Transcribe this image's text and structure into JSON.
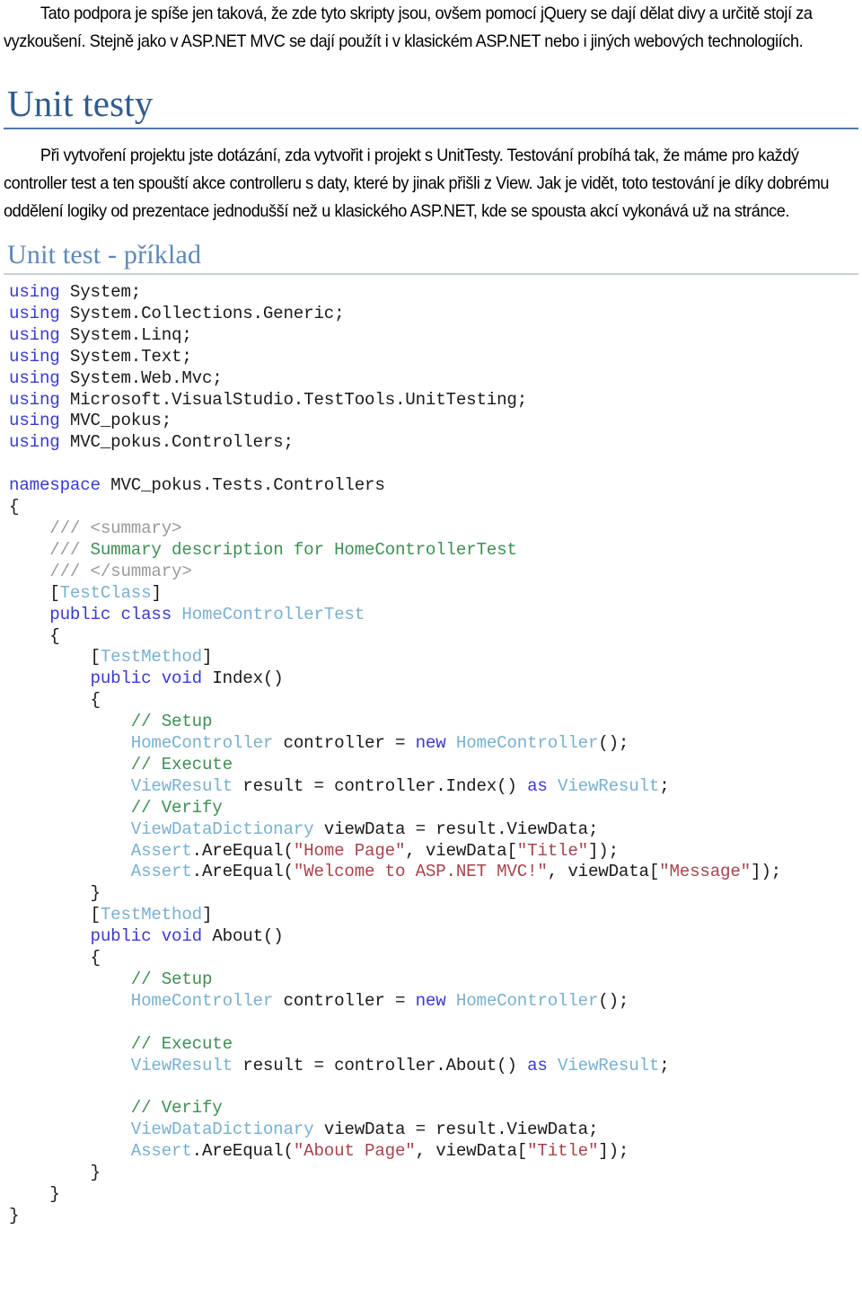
{
  "document": {
    "intro_paragraph": "Tato podpora je spíše jen taková, že zde tyto skripty jsou, ovšem pomocí jQuery se dají dělat divy a určitě stojí za vyzkoušení. Stejně jako v ASP.NET MVC se dají použít i v klasickém ASP.NET nebo i jiných webových technologiích.",
    "heading1": "Unit testy",
    "section_paragraph": "Při vytvoření projektu jste dotázání, zda vytvořit i projekt s UnitTesty. Testování probíhá tak, že máme pro každý controller test a ten spouští akce controlleru s daty, které by jinak přišli z View. Jak je vidět, toto testování je díky dobrému oddělení logiky od prezentace jednodušší než u klasického ASP.NET, kde se spousta akcí vykonává už na stránce.",
    "heading2": "Unit test - příklad",
    "colors": {
      "heading1": "#2f5c8c",
      "heading1_rule": "#4a7ab0",
      "heading2": "#5b87b8",
      "heading2_rule": "#c9ced6",
      "keyword": "#3a3ad0",
      "type": "#79b0d0",
      "comment": "#3f8f55",
      "doc_comment": "#9a9a9a",
      "string": "#a8434c",
      "plain": "#1a1a1a",
      "background": "#ffffff"
    },
    "code_listing": {
      "language": "csharp",
      "lines": [
        [
          {
            "t": "using",
            "c": "kw"
          },
          {
            "t": " System;",
            "c": "pln"
          }
        ],
        [
          {
            "t": "using",
            "c": "kw"
          },
          {
            "t": " System.Collections.Generic;",
            "c": "pln"
          }
        ],
        [
          {
            "t": "using",
            "c": "kw"
          },
          {
            "t": " System.Linq;",
            "c": "pln"
          }
        ],
        [
          {
            "t": "using",
            "c": "kw"
          },
          {
            "t": " System.Text;",
            "c": "pln"
          }
        ],
        [
          {
            "t": "using",
            "c": "kw"
          },
          {
            "t": " System.Web.Mvc;",
            "c": "pln"
          }
        ],
        [
          {
            "t": "using",
            "c": "kw"
          },
          {
            "t": " Microsoft.VisualStudio.TestTools.UnitTesting;",
            "c": "pln"
          }
        ],
        [
          {
            "t": "using",
            "c": "kw"
          },
          {
            "t": " MVC_pokus;",
            "c": "pln"
          }
        ],
        [
          {
            "t": "using",
            "c": "kw"
          },
          {
            "t": " MVC_pokus.Controllers;",
            "c": "pln"
          }
        ],
        [],
        [
          {
            "t": "namespace",
            "c": "kw"
          },
          {
            "t": " MVC_pokus.Tests.Controllers",
            "c": "pln"
          }
        ],
        [
          {
            "t": "{",
            "c": "pln"
          }
        ],
        [
          {
            "t": "    ",
            "c": "pln"
          },
          {
            "t": "///",
            "c": "doc"
          },
          {
            "t": " ",
            "c": "pln"
          },
          {
            "t": "<summary>",
            "c": "doc"
          }
        ],
        [
          {
            "t": "    ",
            "c": "pln"
          },
          {
            "t": "///",
            "c": "doc"
          },
          {
            "t": " ",
            "c": "pln"
          },
          {
            "t": "Summary description for HomeControllerTest",
            "c": "cmt"
          }
        ],
        [
          {
            "t": "    ",
            "c": "pln"
          },
          {
            "t": "///",
            "c": "doc"
          },
          {
            "t": " ",
            "c": "pln"
          },
          {
            "t": "</summary>",
            "c": "doc"
          }
        ],
        [
          {
            "t": "    [",
            "c": "pln"
          },
          {
            "t": "TestClass",
            "c": "typ"
          },
          {
            "t": "]",
            "c": "pln"
          }
        ],
        [
          {
            "t": "    ",
            "c": "pln"
          },
          {
            "t": "public",
            "c": "kw"
          },
          {
            "t": " ",
            "c": "pln"
          },
          {
            "t": "class",
            "c": "kw"
          },
          {
            "t": " ",
            "c": "pln"
          },
          {
            "t": "HomeControllerTest",
            "c": "typ"
          }
        ],
        [
          {
            "t": "    {",
            "c": "pln"
          }
        ],
        [
          {
            "t": "        [",
            "c": "pln"
          },
          {
            "t": "TestMethod",
            "c": "typ"
          },
          {
            "t": "]",
            "c": "pln"
          }
        ],
        [
          {
            "t": "        ",
            "c": "pln"
          },
          {
            "t": "public",
            "c": "kw"
          },
          {
            "t": " ",
            "c": "pln"
          },
          {
            "t": "void",
            "c": "kw"
          },
          {
            "t": " Index()",
            "c": "pln"
          }
        ],
        [
          {
            "t": "        {",
            "c": "pln"
          }
        ],
        [
          {
            "t": "            ",
            "c": "pln"
          },
          {
            "t": "// Setup",
            "c": "cmt"
          }
        ],
        [
          {
            "t": "            ",
            "c": "pln"
          },
          {
            "t": "HomeController",
            "c": "typ"
          },
          {
            "t": " controller = ",
            "c": "pln"
          },
          {
            "t": "new",
            "c": "kw"
          },
          {
            "t": " ",
            "c": "pln"
          },
          {
            "t": "HomeController",
            "c": "typ"
          },
          {
            "t": "();",
            "c": "pln"
          }
        ],
        [
          {
            "t": "            ",
            "c": "pln"
          },
          {
            "t": "// Execute",
            "c": "cmt"
          }
        ],
        [
          {
            "t": "            ",
            "c": "pln"
          },
          {
            "t": "ViewResult",
            "c": "typ"
          },
          {
            "t": " result = controller.Index() ",
            "c": "pln"
          },
          {
            "t": "as",
            "c": "kw"
          },
          {
            "t": " ",
            "c": "pln"
          },
          {
            "t": "ViewResult",
            "c": "typ"
          },
          {
            "t": ";",
            "c": "pln"
          }
        ],
        [
          {
            "t": "            ",
            "c": "pln"
          },
          {
            "t": "// Verify",
            "c": "cmt"
          }
        ],
        [
          {
            "t": "            ",
            "c": "pln"
          },
          {
            "t": "ViewDataDictionary",
            "c": "typ"
          },
          {
            "t": " viewData = result.ViewData;",
            "c": "pln"
          }
        ],
        [
          {
            "t": "            ",
            "c": "pln"
          },
          {
            "t": "Assert",
            "c": "typ"
          },
          {
            "t": ".AreEqual(",
            "c": "pln"
          },
          {
            "t": "\"Home Page\"",
            "c": "str"
          },
          {
            "t": ", viewData[",
            "c": "pln"
          },
          {
            "t": "\"Title\"",
            "c": "str"
          },
          {
            "t": "]);",
            "c": "pln"
          }
        ],
        [
          {
            "t": "            ",
            "c": "pln"
          },
          {
            "t": "Assert",
            "c": "typ"
          },
          {
            "t": ".AreEqual(",
            "c": "pln"
          },
          {
            "t": "\"Welcome to ASP.NET MVC!\"",
            "c": "str"
          },
          {
            "t": ", viewData[",
            "c": "pln"
          },
          {
            "t": "\"Message\"",
            "c": "str"
          },
          {
            "t": "]);",
            "c": "pln"
          }
        ],
        [
          {
            "t": "        }",
            "c": "pln"
          }
        ],
        [
          {
            "t": "        [",
            "c": "pln"
          },
          {
            "t": "TestMethod",
            "c": "typ"
          },
          {
            "t": "]",
            "c": "pln"
          }
        ],
        [
          {
            "t": "        ",
            "c": "pln"
          },
          {
            "t": "public",
            "c": "kw"
          },
          {
            "t": " ",
            "c": "pln"
          },
          {
            "t": "void",
            "c": "kw"
          },
          {
            "t": " About()",
            "c": "pln"
          }
        ],
        [
          {
            "t": "        {",
            "c": "pln"
          }
        ],
        [
          {
            "t": "            ",
            "c": "pln"
          },
          {
            "t": "// Setup",
            "c": "cmt"
          }
        ],
        [
          {
            "t": "            ",
            "c": "pln"
          },
          {
            "t": "HomeController",
            "c": "typ"
          },
          {
            "t": " controller = ",
            "c": "pln"
          },
          {
            "t": "new",
            "c": "kw"
          },
          {
            "t": " ",
            "c": "pln"
          },
          {
            "t": "HomeController",
            "c": "typ"
          },
          {
            "t": "();",
            "c": "pln"
          }
        ],
        [],
        [
          {
            "t": "            ",
            "c": "pln"
          },
          {
            "t": "// Execute",
            "c": "cmt"
          }
        ],
        [
          {
            "t": "            ",
            "c": "pln"
          },
          {
            "t": "ViewResult",
            "c": "typ"
          },
          {
            "t": " result = controller.About() ",
            "c": "pln"
          },
          {
            "t": "as",
            "c": "kw"
          },
          {
            "t": " ",
            "c": "pln"
          },
          {
            "t": "ViewResult",
            "c": "typ"
          },
          {
            "t": ";",
            "c": "pln"
          }
        ],
        [],
        [
          {
            "t": "            ",
            "c": "pln"
          },
          {
            "t": "// Verify",
            "c": "cmt"
          }
        ],
        [
          {
            "t": "            ",
            "c": "pln"
          },
          {
            "t": "ViewDataDictionary",
            "c": "typ"
          },
          {
            "t": " viewData = result.ViewData;",
            "c": "pln"
          }
        ],
        [
          {
            "t": "            ",
            "c": "pln"
          },
          {
            "t": "Assert",
            "c": "typ"
          },
          {
            "t": ".AreEqual(",
            "c": "pln"
          },
          {
            "t": "\"About Page\"",
            "c": "str"
          },
          {
            "t": ", viewData[",
            "c": "pln"
          },
          {
            "t": "\"Title\"",
            "c": "str"
          },
          {
            "t": "]);",
            "c": "pln"
          }
        ],
        [
          {
            "t": "        }",
            "c": "pln"
          }
        ],
        [
          {
            "t": "    }",
            "c": "pln"
          }
        ],
        [
          {
            "t": "}",
            "c": "pln"
          }
        ]
      ]
    }
  }
}
